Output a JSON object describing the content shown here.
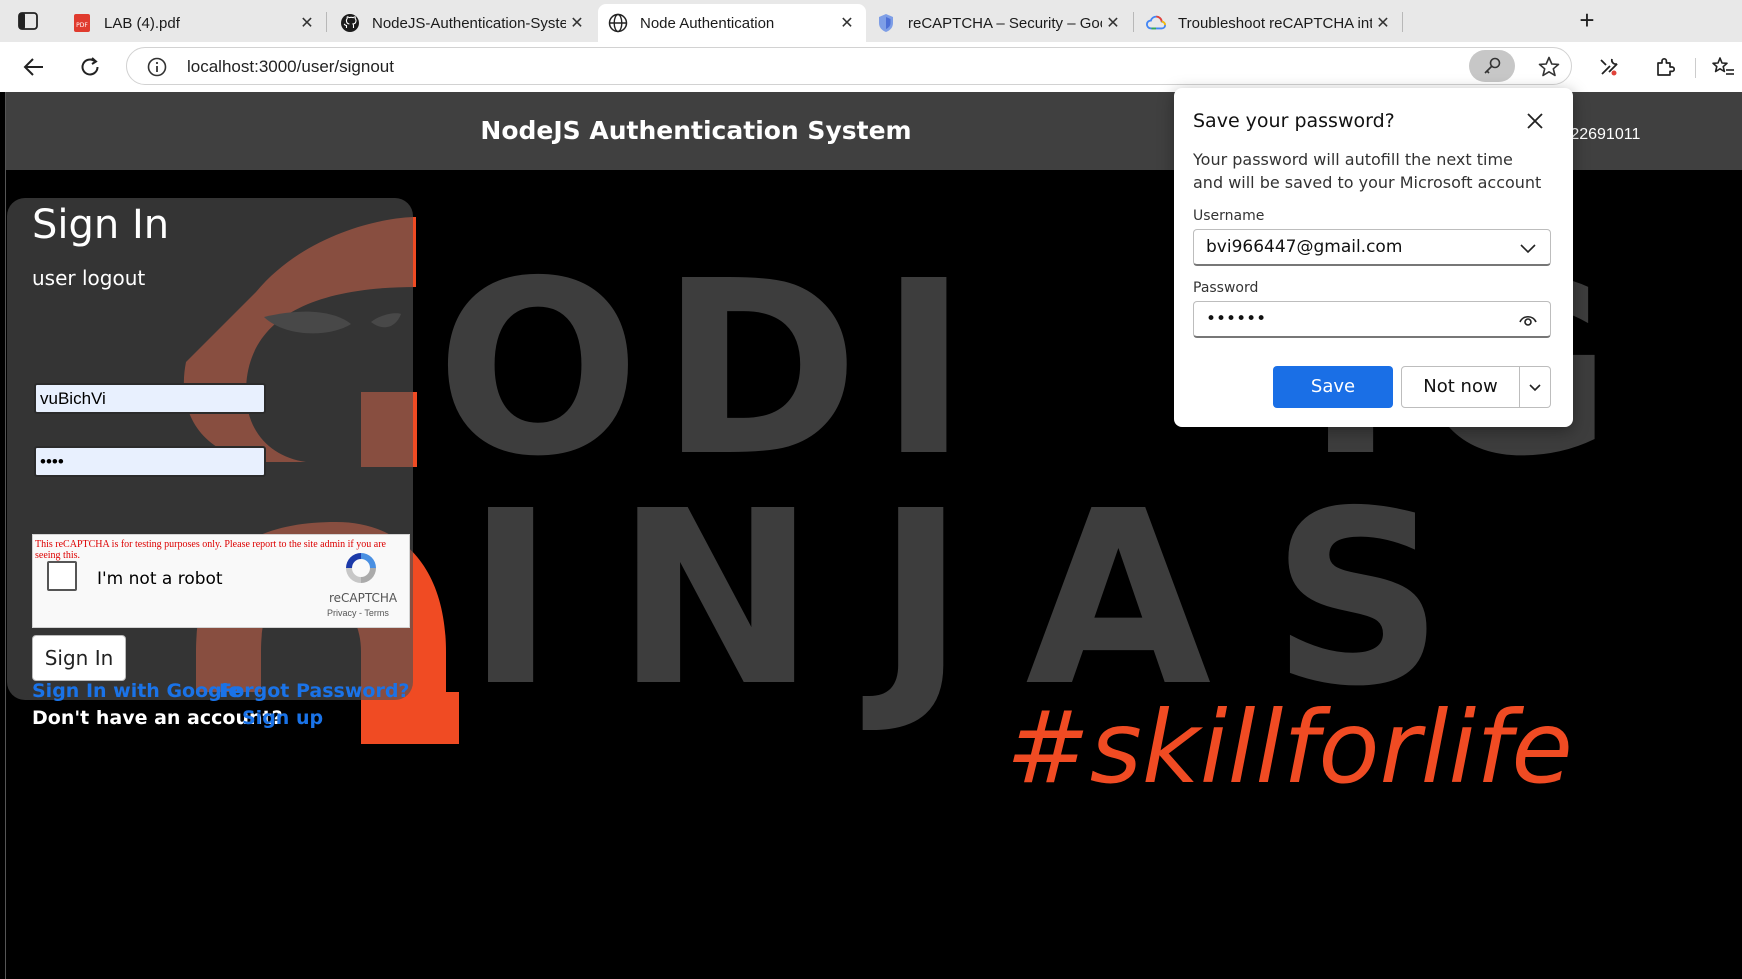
{
  "browser": {
    "tabs": [
      {
        "label": "LAB (4).pdf",
        "icon": "pdf-icon",
        "active": false
      },
      {
        "label": "NodeJS-Authentication-System/p",
        "icon": "github-icon",
        "active": false
      },
      {
        "label": "Node Authentication",
        "icon": "globe-icon",
        "active": true
      },
      {
        "label": "reCAPTCHA – Security – Google C",
        "icon": "shield-icon",
        "active": false
      },
      {
        "label": "Troubleshoot reCAPTCHA integrat",
        "icon": "google-cloud-icon",
        "active": false
      }
    ],
    "url": "localhost:3000/user/signout"
  },
  "site": {
    "title": "NodeJS Authentication System",
    "visitors": "/: 22691011",
    "background_slogan": "#skillforlife",
    "background_wordmark": [
      "ODI",
      "IG",
      "INJAS"
    ]
  },
  "signin": {
    "heading": "Sign In",
    "status": "user logout",
    "username_value": "vuBichVi",
    "password_value": "••••",
    "captcha": {
      "warning": "This reCAPTCHA is for testing purposes only. Please report to the site admin if you are seeing this.",
      "checkbox_label": "I'm not a robot",
      "brand": "reCAPTCHA",
      "legal": "Privacy - Terms"
    },
    "submit_label": "Sign In",
    "google_link": "Sign In with Google",
    "forgot_link": "Forgot Password?",
    "no_account_text": "Don't have an account?",
    "signup_link": "Sign up"
  },
  "password_popup": {
    "title": "Save your password?",
    "description": "Your password will autofill the next time and will be saved to your Microsoft account",
    "username_label": "Username",
    "username_value": "bvi966447@gmail.com",
    "password_label": "Password",
    "password_value": "••••••",
    "save_label": "Save",
    "not_now_label": "Not now"
  },
  "colors": {
    "accent_orange": "#f04b23",
    "save_blue": "#1a6fe6",
    "link_blue": "#1a73e8",
    "header_gray": "#404040"
  }
}
